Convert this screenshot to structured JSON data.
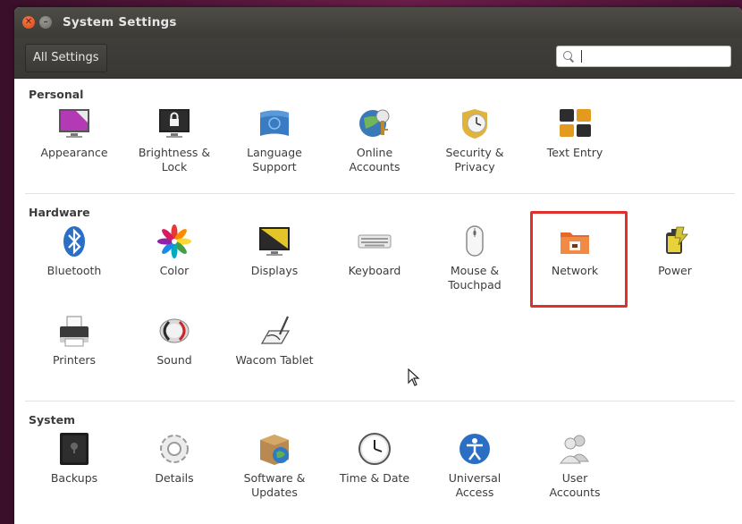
{
  "window": {
    "title": "System Settings"
  },
  "toolbar": {
    "all_settings_label": "All Settings",
    "search_value": "",
    "search_placeholder": ""
  },
  "sections": [
    {
      "title": "Personal",
      "items": [
        {
          "label": "Appearance",
          "icon": "appearance-icon"
        },
        {
          "label": "Brightness &\nLock",
          "icon": "brightness-lock-icon"
        },
        {
          "label": "Language\nSupport",
          "icon": "language-support-icon"
        },
        {
          "label": "Online\nAccounts",
          "icon": "online-accounts-icon"
        },
        {
          "label": "Security &\nPrivacy",
          "icon": "security-privacy-icon"
        },
        {
          "label": "Text Entry",
          "icon": "text-entry-icon"
        }
      ]
    },
    {
      "title": "Hardware",
      "items": [
        {
          "label": "Bluetooth",
          "icon": "bluetooth-icon"
        },
        {
          "label": "Color",
          "icon": "color-icon"
        },
        {
          "label": "Displays",
          "icon": "displays-icon"
        },
        {
          "label": "Keyboard",
          "icon": "keyboard-icon"
        },
        {
          "label": "Mouse &\nTouchpad",
          "icon": "mouse-touchpad-icon"
        },
        {
          "label": "Network",
          "icon": "network-icon"
        },
        {
          "label": "Power",
          "icon": "power-icon"
        },
        {
          "label": "Printers",
          "icon": "printers-icon"
        },
        {
          "label": "Sound",
          "icon": "sound-icon"
        },
        {
          "label": "Wacom Tablet",
          "icon": "wacom-tablet-icon"
        }
      ]
    },
    {
      "title": "System",
      "items": [
        {
          "label": "Backups",
          "icon": "backups-icon"
        },
        {
          "label": "Details",
          "icon": "details-icon"
        },
        {
          "label": "Software &\nUpdates",
          "icon": "software-updates-icon"
        },
        {
          "label": "Time & Date",
          "icon": "time-date-icon"
        },
        {
          "label": "Universal\nAccess",
          "icon": "universal-access-icon"
        },
        {
          "label": "User\nAccounts",
          "icon": "user-accounts-icon"
        }
      ]
    }
  ],
  "colors": {
    "highlight": "#e0302c",
    "titlebar": "#3d3b37",
    "close_button": "#d94816"
  }
}
